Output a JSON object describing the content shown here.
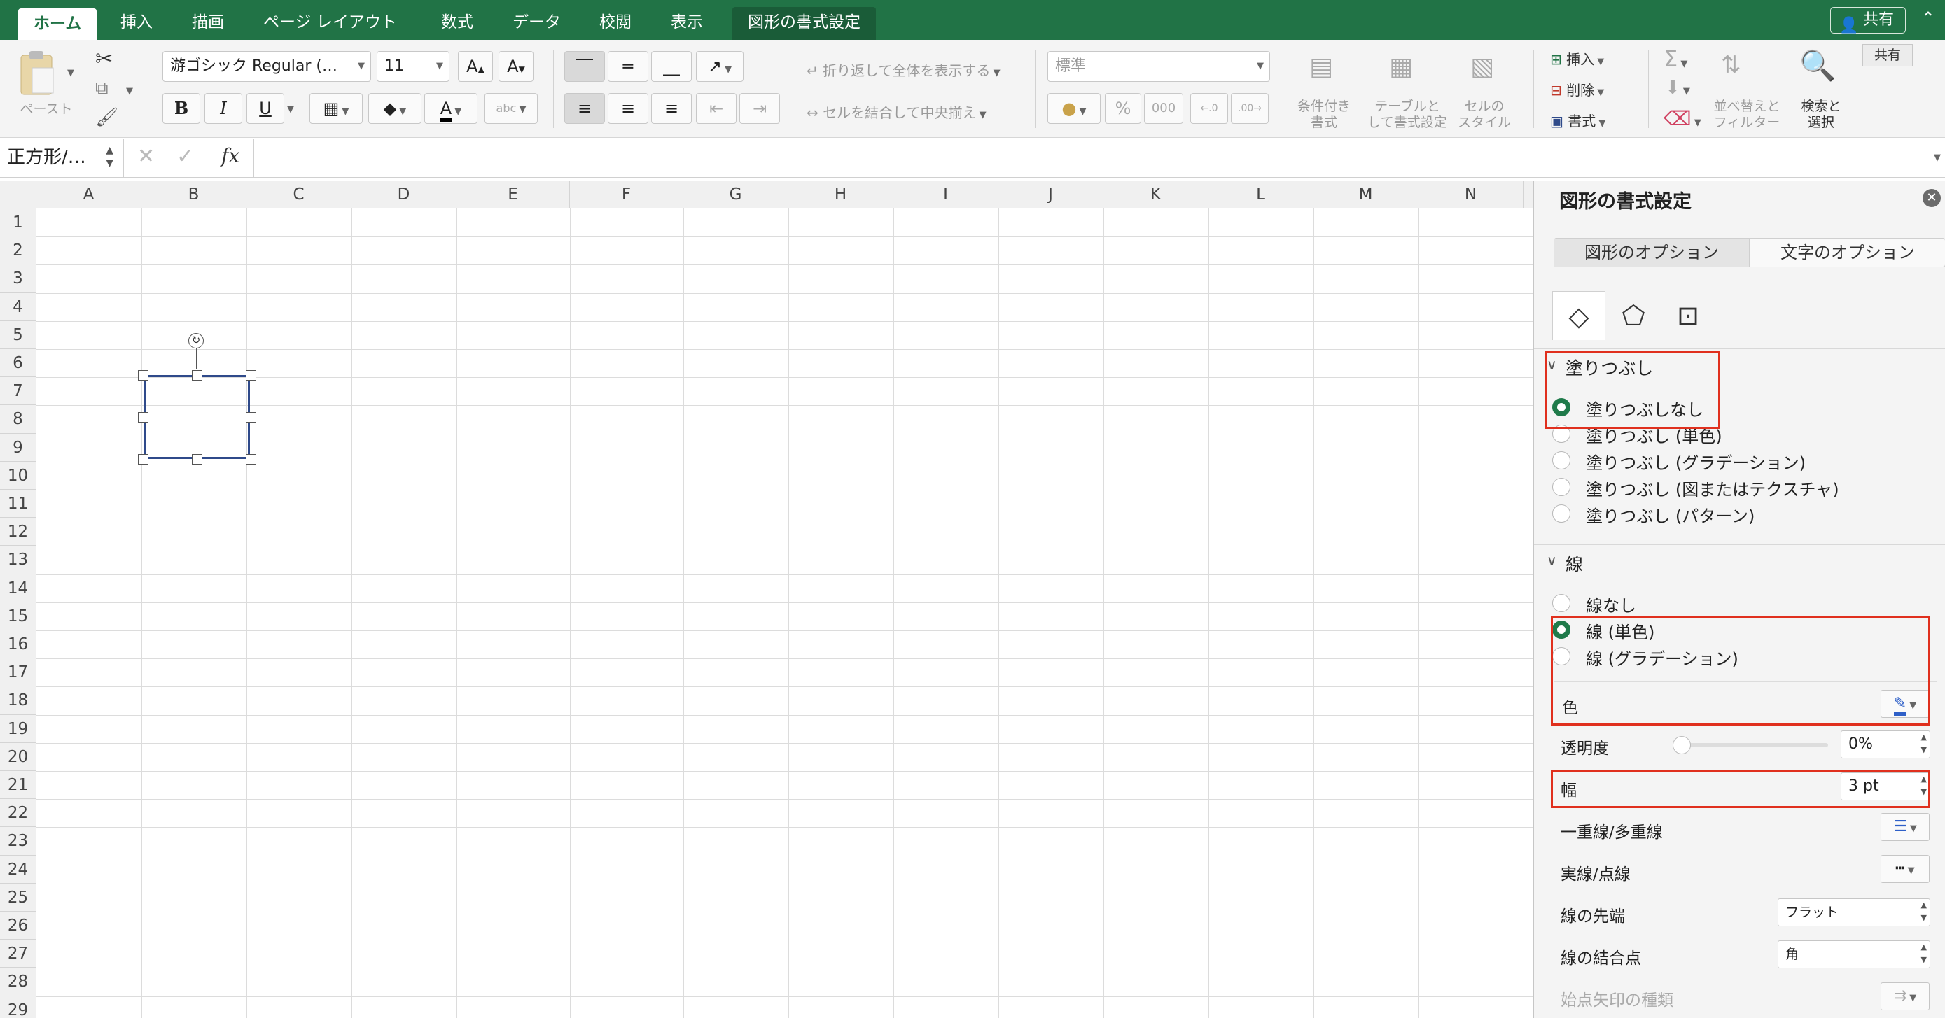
{
  "tabs": [
    "ホーム",
    "挿入",
    "描画",
    "ページ レイアウト",
    "数式",
    "データ",
    "校閲",
    "表示",
    "図形の書式設定"
  ],
  "share": {
    "label": "共有",
    "tooltip": "共有"
  },
  "ribbon": {
    "paste": "ペースト",
    "font_name": "游ゴシック Regular (…",
    "font_size": "11",
    "bold": "B",
    "italic": "I",
    "underline": "U",
    "wrap_text": "折り返して全体を表示する",
    "merge_center": "セルを結合して中央揃え",
    "number_format": "標準",
    "percent": "%",
    "comma": "000",
    "cond_format": [
      "条件付き",
      "書式"
    ],
    "table_format": [
      "テーブルと",
      "して書式設定"
    ],
    "cell_styles": [
      "セルの",
      "スタイル"
    ],
    "insert": "挿入",
    "delete": "削除",
    "format": "書式",
    "sort_filter": [
      "並べ替えと",
      "フィルター"
    ],
    "find_select": [
      "検索と",
      "選択"
    ]
  },
  "formula_bar": {
    "name_box": "正方形/…",
    "fx": "fx"
  },
  "columns": [
    "A",
    "B",
    "C",
    "D",
    "E",
    "F",
    "G",
    "H",
    "I",
    "J",
    "K",
    "L",
    "M",
    "N"
  ],
  "rows": [
    "1",
    "2",
    "3",
    "4",
    "5",
    "6",
    "7",
    "8",
    "9",
    "10",
    "11",
    "12",
    "13",
    "14",
    "15",
    "16",
    "17",
    "18",
    "19",
    "20",
    "21",
    "22",
    "23",
    "24",
    "25",
    "26",
    "27",
    "28",
    "29"
  ],
  "pane": {
    "title": "図形の書式設定",
    "option_tabs": [
      "図形のオプション",
      "文字のオプション"
    ],
    "fill": {
      "header": "塗りつぶし",
      "options": [
        "塗りつぶしなし",
        "塗りつぶし (単色)",
        "塗りつぶし (グラデーション)",
        "塗りつぶし (図またはテクスチャ)",
        "塗りつぶし (パターン)"
      ],
      "selected": 0
    },
    "line": {
      "header": "線",
      "options": [
        "線なし",
        "線 (単色)",
        "線 (グラデーション)"
      ],
      "selected": 1,
      "color_label": "色",
      "transparency_label": "透明度",
      "transparency_value": "0%",
      "width_label": "幅",
      "width_value": "3 pt",
      "compound_label": "一重線/多重線",
      "dash_label": "実線/点線",
      "cap_label": "線の先端",
      "cap_value": "フラット",
      "join_label": "線の結合点",
      "join_value": "角",
      "begin_arrow_label": "始点矢印の種類"
    }
  },
  "colors": {
    "accent": "#217346",
    "highlight": "#e0301e",
    "shape_border": "#2f4a8a"
  }
}
